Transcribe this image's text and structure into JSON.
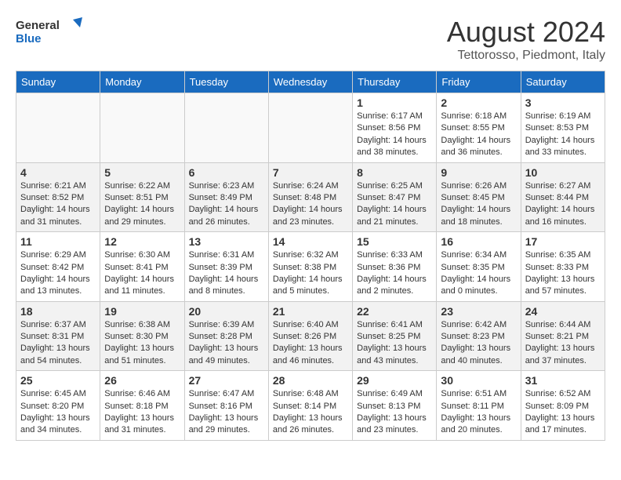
{
  "logo": {
    "line1": "General",
    "line2": "Blue"
  },
  "title": "August 2024",
  "subtitle": "Tettorosso, Piedmont, Italy",
  "weekdays": [
    "Sunday",
    "Monday",
    "Tuesday",
    "Wednesday",
    "Thursday",
    "Friday",
    "Saturday"
  ],
  "weeks": [
    [
      {
        "day": "",
        "sunrise": "",
        "sunset": "",
        "daylight": ""
      },
      {
        "day": "",
        "sunrise": "",
        "sunset": "",
        "daylight": ""
      },
      {
        "day": "",
        "sunrise": "",
        "sunset": "",
        "daylight": ""
      },
      {
        "day": "",
        "sunrise": "",
        "sunset": "",
        "daylight": ""
      },
      {
        "day": "1",
        "sunrise": "Sunrise: 6:17 AM",
        "sunset": "Sunset: 8:56 PM",
        "daylight": "Daylight: 14 hours and 38 minutes."
      },
      {
        "day": "2",
        "sunrise": "Sunrise: 6:18 AM",
        "sunset": "Sunset: 8:55 PM",
        "daylight": "Daylight: 14 hours and 36 minutes."
      },
      {
        "day": "3",
        "sunrise": "Sunrise: 6:19 AM",
        "sunset": "Sunset: 8:53 PM",
        "daylight": "Daylight: 14 hours and 33 minutes."
      }
    ],
    [
      {
        "day": "4",
        "sunrise": "Sunrise: 6:21 AM",
        "sunset": "Sunset: 8:52 PM",
        "daylight": "Daylight: 14 hours and 31 minutes."
      },
      {
        "day": "5",
        "sunrise": "Sunrise: 6:22 AM",
        "sunset": "Sunset: 8:51 PM",
        "daylight": "Daylight: 14 hours and 29 minutes."
      },
      {
        "day": "6",
        "sunrise": "Sunrise: 6:23 AM",
        "sunset": "Sunset: 8:49 PM",
        "daylight": "Daylight: 14 hours and 26 minutes."
      },
      {
        "day": "7",
        "sunrise": "Sunrise: 6:24 AM",
        "sunset": "Sunset: 8:48 PM",
        "daylight": "Daylight: 14 hours and 23 minutes."
      },
      {
        "day": "8",
        "sunrise": "Sunrise: 6:25 AM",
        "sunset": "Sunset: 8:47 PM",
        "daylight": "Daylight: 14 hours and 21 minutes."
      },
      {
        "day": "9",
        "sunrise": "Sunrise: 6:26 AM",
        "sunset": "Sunset: 8:45 PM",
        "daylight": "Daylight: 14 hours and 18 minutes."
      },
      {
        "day": "10",
        "sunrise": "Sunrise: 6:27 AM",
        "sunset": "Sunset: 8:44 PM",
        "daylight": "Daylight: 14 hours and 16 minutes."
      }
    ],
    [
      {
        "day": "11",
        "sunrise": "Sunrise: 6:29 AM",
        "sunset": "Sunset: 8:42 PM",
        "daylight": "Daylight: 14 hours and 13 minutes."
      },
      {
        "day": "12",
        "sunrise": "Sunrise: 6:30 AM",
        "sunset": "Sunset: 8:41 PM",
        "daylight": "Daylight: 14 hours and 11 minutes."
      },
      {
        "day": "13",
        "sunrise": "Sunrise: 6:31 AM",
        "sunset": "Sunset: 8:39 PM",
        "daylight": "Daylight: 14 hours and 8 minutes."
      },
      {
        "day": "14",
        "sunrise": "Sunrise: 6:32 AM",
        "sunset": "Sunset: 8:38 PM",
        "daylight": "Daylight: 14 hours and 5 minutes."
      },
      {
        "day": "15",
        "sunrise": "Sunrise: 6:33 AM",
        "sunset": "Sunset: 8:36 PM",
        "daylight": "Daylight: 14 hours and 2 minutes."
      },
      {
        "day": "16",
        "sunrise": "Sunrise: 6:34 AM",
        "sunset": "Sunset: 8:35 PM",
        "daylight": "Daylight: 14 hours and 0 minutes."
      },
      {
        "day": "17",
        "sunrise": "Sunrise: 6:35 AM",
        "sunset": "Sunset: 8:33 PM",
        "daylight": "Daylight: 13 hours and 57 minutes."
      }
    ],
    [
      {
        "day": "18",
        "sunrise": "Sunrise: 6:37 AM",
        "sunset": "Sunset: 8:31 PM",
        "daylight": "Daylight: 13 hours and 54 minutes."
      },
      {
        "day": "19",
        "sunrise": "Sunrise: 6:38 AM",
        "sunset": "Sunset: 8:30 PM",
        "daylight": "Daylight: 13 hours and 51 minutes."
      },
      {
        "day": "20",
        "sunrise": "Sunrise: 6:39 AM",
        "sunset": "Sunset: 8:28 PM",
        "daylight": "Daylight: 13 hours and 49 minutes."
      },
      {
        "day": "21",
        "sunrise": "Sunrise: 6:40 AM",
        "sunset": "Sunset: 8:26 PM",
        "daylight": "Daylight: 13 hours and 46 minutes."
      },
      {
        "day": "22",
        "sunrise": "Sunrise: 6:41 AM",
        "sunset": "Sunset: 8:25 PM",
        "daylight": "Daylight: 13 hours and 43 minutes."
      },
      {
        "day": "23",
        "sunrise": "Sunrise: 6:42 AM",
        "sunset": "Sunset: 8:23 PM",
        "daylight": "Daylight: 13 hours and 40 minutes."
      },
      {
        "day": "24",
        "sunrise": "Sunrise: 6:44 AM",
        "sunset": "Sunset: 8:21 PM",
        "daylight": "Daylight: 13 hours and 37 minutes."
      }
    ],
    [
      {
        "day": "25",
        "sunrise": "Sunrise: 6:45 AM",
        "sunset": "Sunset: 8:20 PM",
        "daylight": "Daylight: 13 hours and 34 minutes."
      },
      {
        "day": "26",
        "sunrise": "Sunrise: 6:46 AM",
        "sunset": "Sunset: 8:18 PM",
        "daylight": "Daylight: 13 hours and 31 minutes."
      },
      {
        "day": "27",
        "sunrise": "Sunrise: 6:47 AM",
        "sunset": "Sunset: 8:16 PM",
        "daylight": "Daylight: 13 hours and 29 minutes."
      },
      {
        "day": "28",
        "sunrise": "Sunrise: 6:48 AM",
        "sunset": "Sunset: 8:14 PM",
        "daylight": "Daylight: 13 hours and 26 minutes."
      },
      {
        "day": "29",
        "sunrise": "Sunrise: 6:49 AM",
        "sunset": "Sunset: 8:13 PM",
        "daylight": "Daylight: 13 hours and 23 minutes."
      },
      {
        "day": "30",
        "sunrise": "Sunrise: 6:51 AM",
        "sunset": "Sunset: 8:11 PM",
        "daylight": "Daylight: 13 hours and 20 minutes."
      },
      {
        "day": "31",
        "sunrise": "Sunrise: 6:52 AM",
        "sunset": "Sunset: 8:09 PM",
        "daylight": "Daylight: 13 hours and 17 minutes."
      }
    ]
  ]
}
